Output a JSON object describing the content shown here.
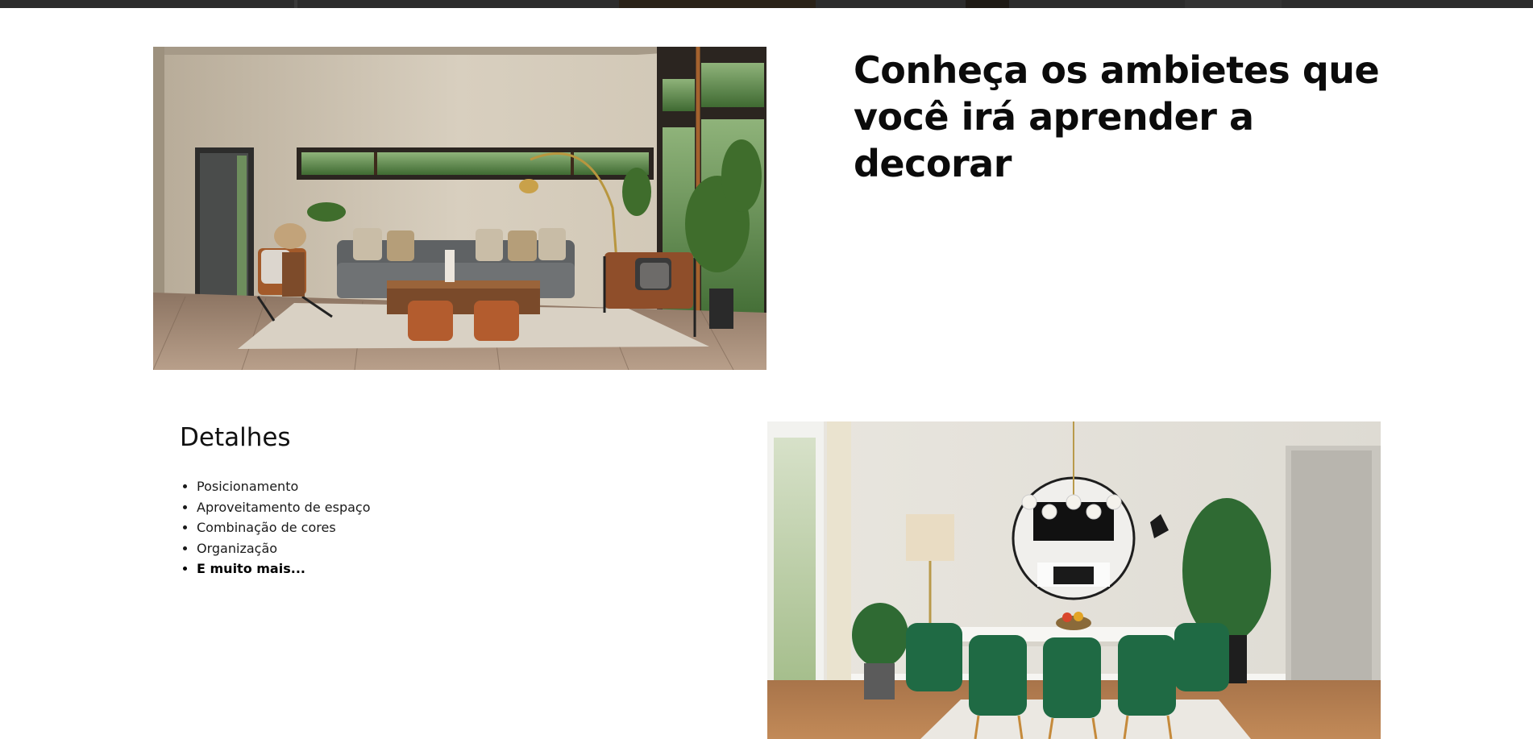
{
  "section": {
    "heading": "Conheça os ambietes que você irá aprender a decorar",
    "details": {
      "title": "Detalhes",
      "items": [
        "Posicionamento",
        "Aproveitamento de espaço",
        "Combinação de cores",
        "Organização",
        "E muito mais..."
      ]
    }
  },
  "images": {
    "living_room": "living-room-photo",
    "dining_room": "dining-room-photo"
  },
  "colors": {
    "text": "#0b0b0b",
    "background": "#ffffff",
    "top_strip": "#2c2c2c"
  }
}
